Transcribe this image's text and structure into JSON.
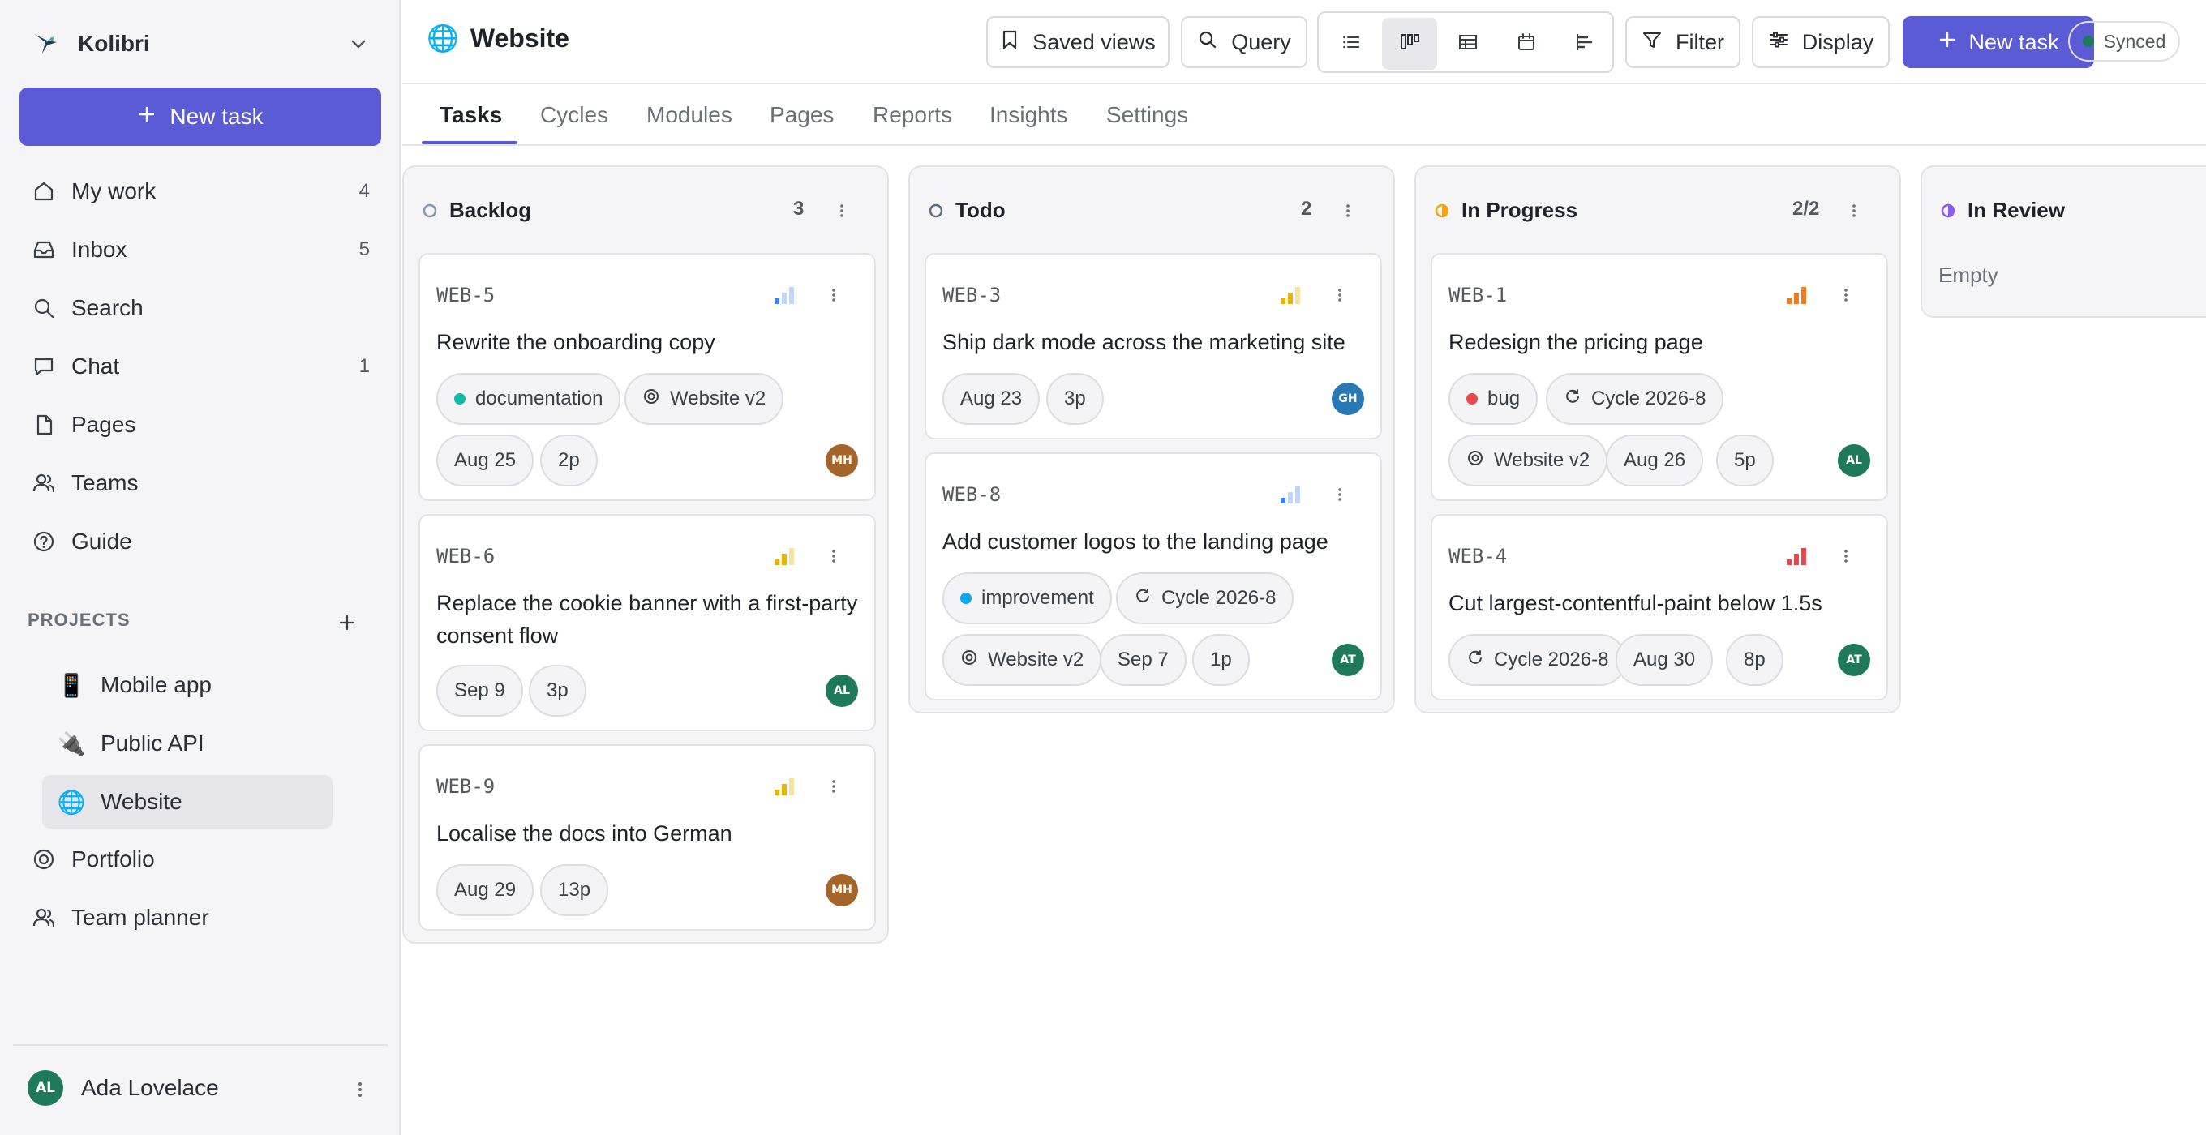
{
  "workspace": {
    "name": "Kolibri"
  },
  "sidebar": {
    "new_task_label": "New task",
    "nav": [
      {
        "label": "My work",
        "count": "4",
        "icon": "home-icon"
      },
      {
        "label": "Inbox",
        "count": "5",
        "icon": "inbox-icon"
      },
      {
        "label": "Search",
        "count": "",
        "icon": "search-icon"
      },
      {
        "label": "Chat",
        "count": "1",
        "icon": "chat-icon"
      },
      {
        "label": "Pages",
        "count": "",
        "icon": "page-icon"
      },
      {
        "label": "Teams",
        "count": "",
        "icon": "users-icon"
      },
      {
        "label": "Guide",
        "count": "",
        "icon": "help-icon"
      }
    ],
    "projects_heading": "PROJECTS",
    "projects": [
      {
        "emoji": "📱",
        "label": "Mobile app"
      },
      {
        "emoji": "🔌",
        "label": "Public API"
      },
      {
        "emoji": "🌐",
        "label": "Website"
      }
    ],
    "extra": [
      {
        "label": "Portfolio",
        "icon": "target-icon"
      },
      {
        "label": "Team planner",
        "icon": "users-icon"
      }
    ],
    "user": {
      "initials": "AL",
      "name": "Ada Lovelace"
    }
  },
  "header": {
    "emoji": "🌐",
    "title": "Website",
    "saved_views": "Saved views",
    "query": "Query",
    "filter": "Filter",
    "display": "Display",
    "new_task": "New task",
    "sync_status": "Synced"
  },
  "tabs": [
    "Tasks",
    "Cycles",
    "Modules",
    "Pages",
    "Reports",
    "Insights",
    "Settings"
  ],
  "colors": {
    "accent": "#5b5bd6",
    "backlog": "#8a97a8",
    "todo": "#5f6b7a",
    "in_progress": "#f2a516",
    "in_review": "#8b5cf6",
    "label_documentation": "#14b8a6",
    "label_bug": "#e5484d",
    "label_improvement": "#0ea5e9"
  },
  "board": {
    "columns": [
      {
        "name": "Backlog",
        "count": "3",
        "cards": [
          {
            "key": "WEB-5",
            "priority": "low",
            "title": "Rewrite the onboarding copy",
            "label": "documentation",
            "module": "Website v2",
            "date": "Aug 25",
            "points": "2p",
            "assignee": "MH"
          },
          {
            "key": "WEB-6",
            "priority": "medium",
            "title": "Replace the cookie banner with a first-party consent flow",
            "date": "Sep 9",
            "points": "3p",
            "assignee": "AL"
          },
          {
            "key": "WEB-9",
            "priority": "medium",
            "title": "Localise the docs into German",
            "date": "Aug 29",
            "points": "13p",
            "assignee": "MH"
          }
        ]
      },
      {
        "name": "Todo",
        "count": "2",
        "cards": [
          {
            "key": "WEB-3",
            "priority": "medium",
            "title": "Ship dark mode across the marketing site",
            "date": "Aug 23",
            "points": "3p",
            "assignee": "GH"
          },
          {
            "key": "WEB-8",
            "priority": "low",
            "title": "Add customer logos to the landing page",
            "label": "improvement",
            "cycle": "Cycle 2026-8",
            "module": "Website v2",
            "date": "Sep 7",
            "points": "1p",
            "assignee": "AT"
          }
        ]
      },
      {
        "name": "In Progress",
        "count": "2/2",
        "cards": [
          {
            "key": "WEB-1",
            "priority": "high",
            "title": "Redesign the pricing page",
            "label": "bug",
            "cycle": "Cycle 2026-8",
            "module": "Website v2",
            "date": "Aug 26",
            "points": "5p",
            "assignee": "AL"
          },
          {
            "key": "WEB-4",
            "priority": "urgent",
            "title": "Cut largest-contentful-paint below 1.5s",
            "cycle": "Cycle 2026-8",
            "date": "Aug 30",
            "points": "8p",
            "assignee": "AT"
          }
        ]
      },
      {
        "name": "In Review",
        "count": "",
        "empty_label": "Empty",
        "cards": []
      }
    ]
  }
}
